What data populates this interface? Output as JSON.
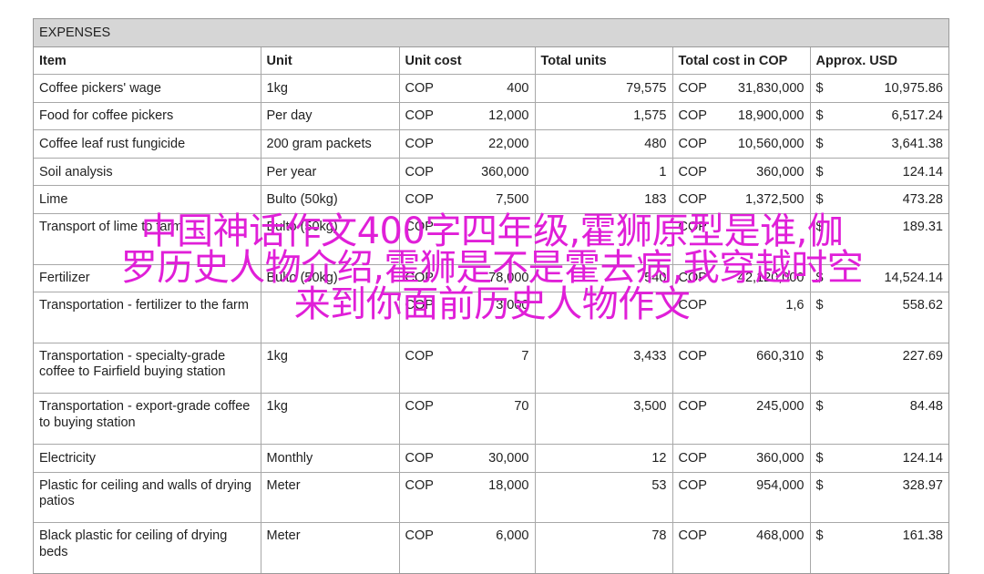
{
  "sheet": {
    "title": "EXPENSES",
    "headers": [
      "Item",
      "Unit",
      "Unit cost",
      "Total units",
      "Total cost in COP",
      "Approx. USD"
    ],
    "currency_cop": "COP",
    "currency_usd": "$",
    "rows": [
      {
        "item": "Coffee pickers' wage",
        "unit": "1kg",
        "unit_cost": "400",
        "total_units": "79,575",
        "total_cop": "31,830,000",
        "usd": "10,975.86"
      },
      {
        "item": "Food for coffee pickers",
        "unit": "Per day",
        "unit_cost": "12,000",
        "total_units": "1,575",
        "total_cop": "18,900,000",
        "usd": "6,517.24"
      },
      {
        "item": "Coffee leaf rust fungicide",
        "unit": "200 gram packets",
        "unit_cost": "22,000",
        "total_units": "480",
        "total_cop": "10,560,000",
        "usd": "3,641.38"
      },
      {
        "item": "Soil analysis",
        "unit": "Per year",
        "unit_cost": "360,000",
        "total_units": "1",
        "total_cop": "360,000",
        "usd": "124.14"
      },
      {
        "item": "Lime",
        "unit": "Bulto (50kg)",
        "unit_cost": "7,500",
        "total_units": "183",
        "total_cop": "1,372,500",
        "usd": "473.28"
      },
      {
        "item": "Transport of lime to farm",
        "unit": "Bulto (50kg)",
        "unit_cost": "",
        "total_units": "",
        "total_cop": "",
        "usd": "189.31"
      },
      {
        "item": "Fertilizer",
        "unit": "Bulto (50kg)",
        "unit_cost": "78,000",
        "total_units": "540",
        "total_cop": "42,120,000",
        "usd": "14,524.14"
      },
      {
        "item": "Transportation - fertilizer to the farm",
        "unit": "",
        "unit_cost": "3,000",
        "total_units": "",
        "total_cop": "1,6",
        "usd": "558.62"
      },
      {
        "item": "Transportation - specialty-grade coffee to Fairfield buying station",
        "unit": "1kg",
        "unit_cost": "7",
        "total_units": "3,433",
        "total_cop": "660,310",
        "usd": "227.69"
      },
      {
        "item": "Transportation - export-grade coffee to buying station",
        "unit": "1kg",
        "unit_cost": "70",
        "total_units": "3,500",
        "total_cop": "245,000",
        "usd": "84.48"
      },
      {
        "item": "Electricity",
        "unit": "Monthly",
        "unit_cost": "30,000",
        "total_units": "12",
        "total_cop": "360,000",
        "usd": "124.14"
      },
      {
        "item": "Plastic for ceiling and walls of drying patios",
        "unit": "Meter",
        "unit_cost": "18,000",
        "total_units": "53",
        "total_cop": "954,000",
        "usd": "328.97"
      },
      {
        "item": "Black plastic for ceiling of drying beds",
        "unit": "Meter",
        "unit_cost": "6,000",
        "total_units": "78",
        "total_cop": "468,000",
        "usd": "161.38"
      }
    ]
  },
  "overlay": {
    "line1": "中国神话作文400字四年级,霍狮原型是谁,伽",
    "line2": "罗历史人物介绍,霍狮是不是霍去病,我穿越时空",
    "line3": "来到你面前历史人物作文"
  }
}
